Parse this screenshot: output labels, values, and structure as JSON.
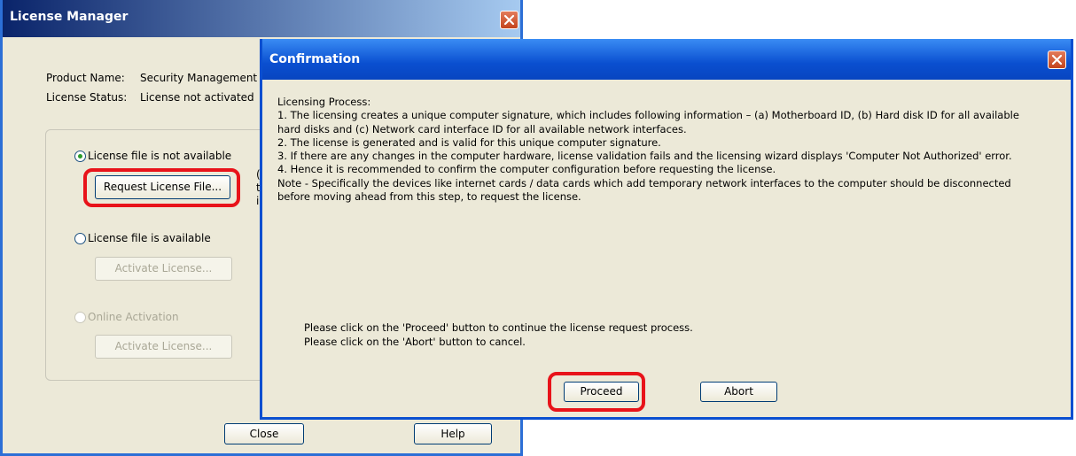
{
  "license_manager": {
    "title": "License Manager",
    "product_name_label": "Product Name:",
    "product_name_value": "Security Management S",
    "license_status_label": "License Status:",
    "license_status_value": "License not activated",
    "options": {
      "not_available_label": "License file is not available",
      "request_button": "Request License File...",
      "side_note": [
        "(I",
        "th",
        "in"
      ],
      "available_label": "License file is available",
      "activate_button_1": "Activate License...",
      "online_label": "Online Activation",
      "activate_button_2": "Activate License..."
    },
    "close_button": "Close",
    "help_button": "Help"
  },
  "confirmation": {
    "title": "Confirmation",
    "heading": "Licensing Process:",
    "lines": [
      "1. The licensing creates a unique computer signature, which includes following information – (a) Motherboard ID, (b) Hard disk ID for all available",
      "hard disks and (c) Network card interface ID for all available network interfaces.",
      "2. The license is generated and is valid for this unique computer signature.",
      "3. If there are any changes in the computer hardware, license validation fails and the licensing wizard displays 'Computer Not Authorized' error.",
      "4. Hence it is recommended to confirm the computer configuration before requesting the license.",
      "Note - Specifically the devices like internet cards / data cards which add temporary network interfaces to the computer should be disconnected",
      "before moving ahead from this step, to request the license."
    ],
    "footer_lines": [
      "Please click on the 'Proceed' button to continue the license request process.",
      "Please click on the 'Abort' button to cancel."
    ],
    "proceed_button": "Proceed",
    "abort_button": "Abort"
  },
  "colors": {
    "title_gradient_start": "#0a246a",
    "title_gradient_end": "#a6caf0",
    "highlight": "#e8131a",
    "window_bg": "#ece9d8"
  }
}
